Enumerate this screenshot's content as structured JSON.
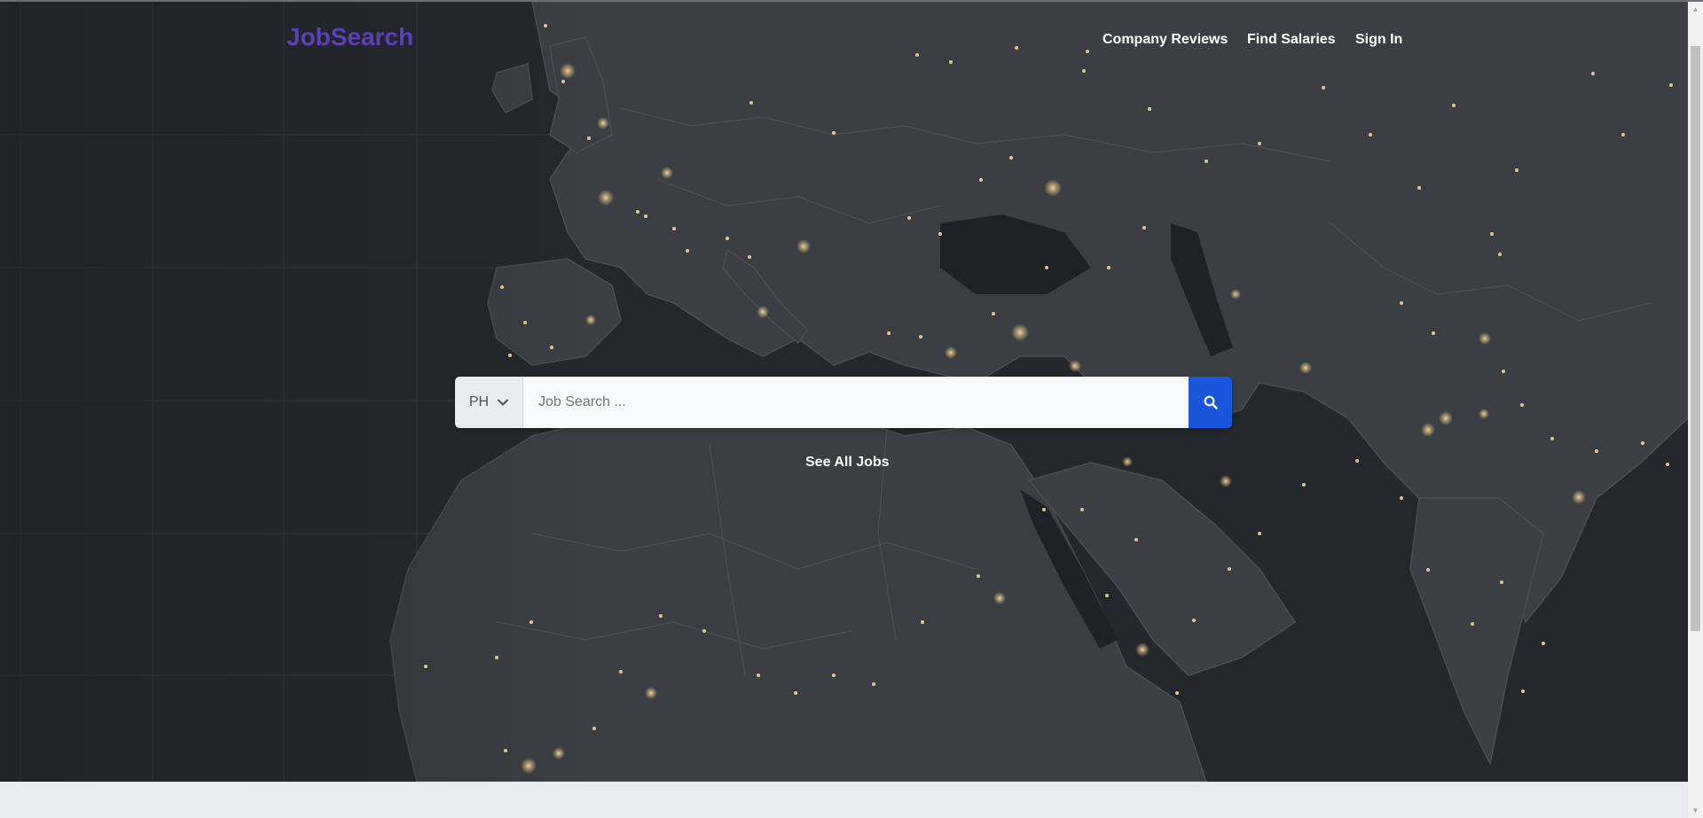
{
  "header": {
    "logo": "JobSearch",
    "nav": [
      {
        "label": "Company Reviews"
      },
      {
        "label": "Find Salaries"
      },
      {
        "label": "Sign In"
      }
    ]
  },
  "search": {
    "country_code": "PH",
    "placeholder": "Job Search ...",
    "value": "",
    "button_icon": "search-icon"
  },
  "links": {
    "see_all": "See All Jobs"
  },
  "colors": {
    "brand": "#5b41b8",
    "search_button": "#1a56db",
    "hero_background": "#26292d",
    "city_lights": "#f3d9a6"
  },
  "background": {
    "image": "world-map-night-lights"
  }
}
